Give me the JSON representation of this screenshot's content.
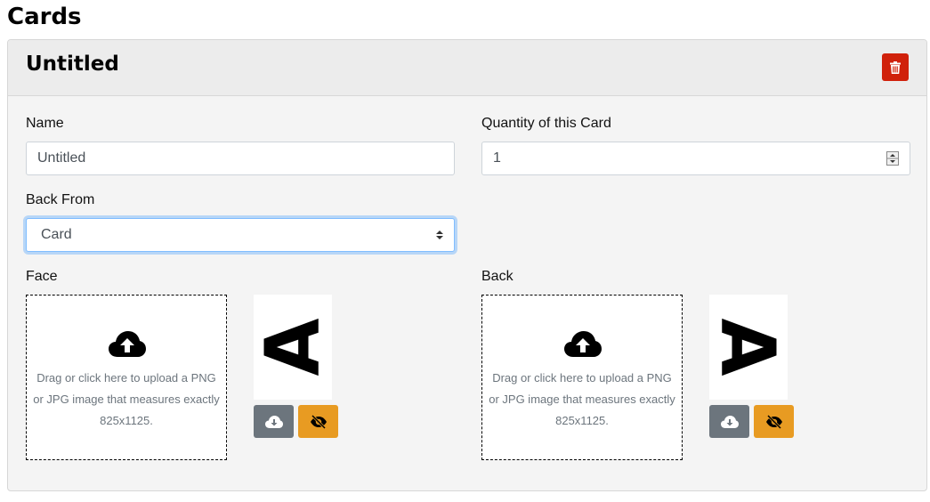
{
  "page": {
    "heading": "Cards"
  },
  "card": {
    "title": "Untitled",
    "delete_icon": "trash-icon",
    "name": {
      "label": "Name",
      "value": "Untitled"
    },
    "quantity": {
      "label": "Quantity of this Card",
      "value": "1"
    },
    "back_from": {
      "label": "Back From",
      "selected": "Card"
    },
    "face": {
      "label": "Face",
      "upload_icon": "cloud-upload-icon",
      "upload_text": "Drag or click here to upload a PNG or JPG image that measures exactly 825x1125.",
      "preview_glyph": "A",
      "download_icon": "cloud-download-icon",
      "hide_icon": "eye-slash-icon"
    },
    "back": {
      "label": "Back",
      "upload_icon": "cloud-upload-icon",
      "upload_text": "Drag or click here to upload a PNG or JPG image that measures exactly 825x1125.",
      "preview_glyph": "A",
      "download_icon": "cloud-download-icon",
      "hide_icon": "eye-slash-icon"
    }
  },
  "colors": {
    "delete": "#d0210b",
    "download": "#6c757d",
    "hide": "#e89b22",
    "focus": "#80bdff"
  }
}
